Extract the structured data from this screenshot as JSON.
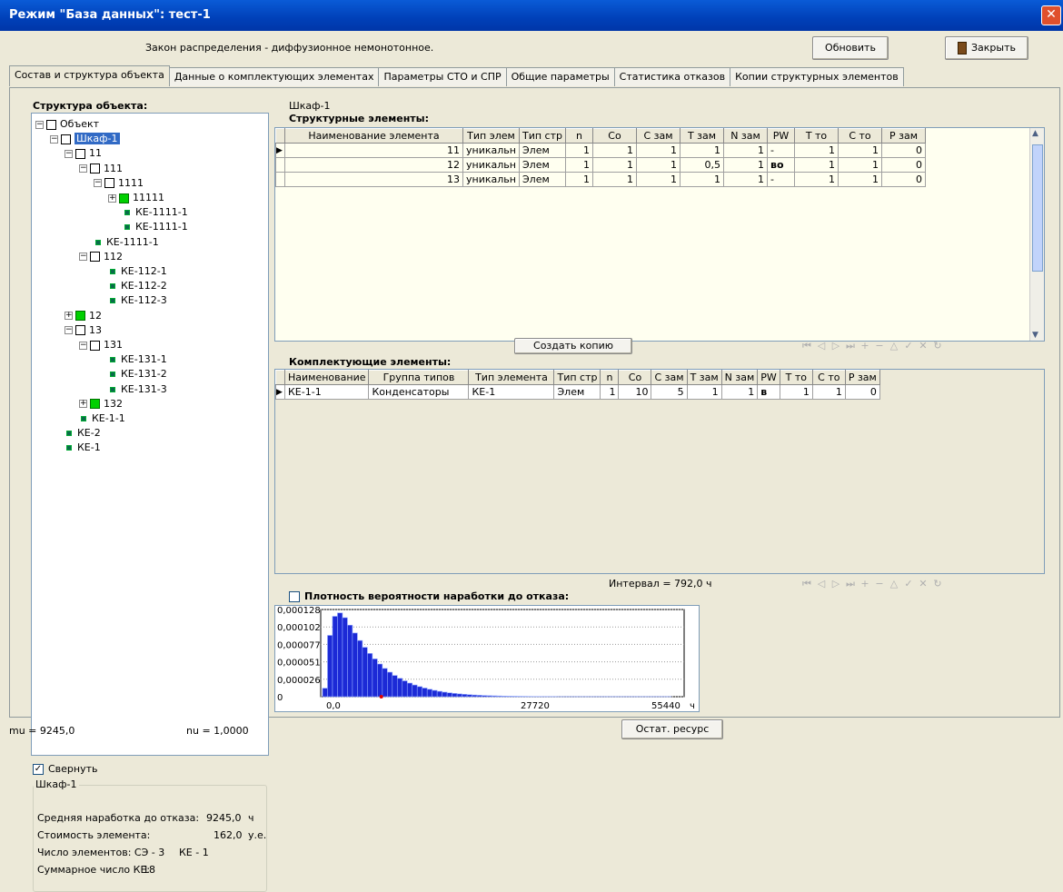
{
  "window": {
    "title": "Режим \"База данных\": тест-1",
    "close": "✕"
  },
  "header": {
    "law_label": "Закон распределения - диффузионное немонотонное.",
    "refresh": "Обновить",
    "close": "Закрыть"
  },
  "tabs": [
    "Состав и структура объекта",
    "Данные о комплектующих элементах",
    "Параметры СТО и СПР",
    "Общие параметры",
    "Статистика отказов",
    "Копии структурных элементов"
  ],
  "tree": {
    "title": "Структура объекта:",
    "nodes": [
      {
        "label": "Объект",
        "level": 0,
        "icon": "box",
        "exp": "−"
      },
      {
        "label": "Шкаф-1",
        "level": 1,
        "icon": "box",
        "exp": "−",
        "selected": true
      },
      {
        "label": "11",
        "level": 2,
        "icon": "box",
        "exp": "−"
      },
      {
        "label": "111",
        "level": 3,
        "icon": "box",
        "exp": "−"
      },
      {
        "label": "1111",
        "level": 4,
        "icon": "box",
        "exp": "−"
      },
      {
        "label": "11111",
        "level": 5,
        "icon": "green",
        "exp": "+"
      },
      {
        "label": "КЕ-1111-1",
        "level": 6,
        "icon": "sq",
        "exp": ""
      },
      {
        "label": "КЕ-1111-1",
        "level": 6,
        "icon": "sq",
        "exp": ""
      },
      {
        "label": "КЕ-1111-1",
        "level": 4,
        "icon": "sq",
        "exp": ""
      },
      {
        "label": "112",
        "level": 3,
        "icon": "plain",
        "exp": "−"
      },
      {
        "label": "КЕ-112-1",
        "level": 5,
        "icon": "sq",
        "exp": ""
      },
      {
        "label": "КЕ-112-2",
        "level": 5,
        "icon": "sq",
        "exp": ""
      },
      {
        "label": "КЕ-112-3",
        "level": 5,
        "icon": "sq",
        "exp": ""
      },
      {
        "label": "12",
        "level": 2,
        "icon": "green",
        "exp": "+"
      },
      {
        "label": "13",
        "level": 2,
        "icon": "box",
        "exp": "−"
      },
      {
        "label": "131",
        "level": 3,
        "icon": "plain",
        "exp": "−"
      },
      {
        "label": "КЕ-131-1",
        "level": 5,
        "icon": "sq",
        "exp": ""
      },
      {
        "label": "КЕ-131-2",
        "level": 5,
        "icon": "sq",
        "exp": ""
      },
      {
        "label": "КЕ-131-3",
        "level": 5,
        "icon": "sq",
        "exp": ""
      },
      {
        "label": "132",
        "level": 3,
        "icon": "green",
        "exp": "+"
      },
      {
        "label": "КЕ-1-1",
        "level": 3,
        "icon": "sq",
        "exp": ""
      },
      {
        "label": "КЕ-2",
        "level": 2,
        "icon": "sq",
        "exp": ""
      },
      {
        "label": "КЕ-1",
        "level": 2,
        "icon": "sq",
        "exp": ""
      }
    ]
  },
  "collapse": {
    "label": "Свернуть",
    "checked": true
  },
  "info": {
    "title": "Шкаф-1",
    "mtbf_label": "Средняя наработка до отказа:",
    "mtbf_value": "9245,0",
    "mtbf_unit": "ч",
    "cost_label": "Стоимость элемента:",
    "cost_value": "162,0",
    "cost_unit": "у.е.",
    "count_label": "Число элементов: СЭ - 3",
    "count_ke": "КЕ - 1",
    "sum_label": "Суммарное число КЕ:",
    "sum_value": "18"
  },
  "selected_name": "Шкаф-1",
  "struct": {
    "title": "Структурные элементы:",
    "headers": [
      "Наименование элемента",
      "Тип элем",
      "Тип стр",
      "n",
      "Co",
      "С зам",
      "Т зам",
      "N зам",
      "PW",
      "Т то",
      "С то",
      "Р зам"
    ],
    "rows": [
      [
        "11",
        "уникальн",
        "Элем",
        "1",
        "1",
        "1",
        "1",
        "1",
        "-",
        "1",
        "1",
        "0"
      ],
      [
        "12",
        "уникальн",
        "Элем",
        "1",
        "1",
        "1",
        "0,5",
        "1",
        "во",
        "1",
        "1",
        "0"
      ],
      [
        "13",
        "уникальн",
        "Элем",
        "1",
        "1",
        "1",
        "1",
        "1",
        "-",
        "1",
        "1",
        "0"
      ]
    ]
  },
  "copy_button": "Создать копию",
  "comp": {
    "title": "Комплектующие элементы:",
    "headers": [
      "Наименование",
      "Группа типов",
      "Тип элемента",
      "Тип стр",
      "n",
      "Co",
      "С зам",
      "Т зам",
      "N зам",
      "PW",
      "Т то",
      "С то",
      "Р зам"
    ],
    "rows": [
      [
        "КЕ-1-1",
        "Конденсаторы",
        "КЕ-1",
        "Элем",
        "1",
        "10",
        "5",
        "1",
        "1",
        "в",
        "1",
        "1",
        "0"
      ]
    ]
  },
  "nav_icons": [
    "⏮",
    "◁",
    "▷",
    "⏭",
    "+",
    "−",
    "△",
    "✓",
    "✕",
    "↻"
  ],
  "interval": "Интервал = 792,0 ч",
  "density": {
    "label": "Плотность вероятности наработки до отказа:",
    "checked": false
  },
  "chart_data": {
    "type": "bar",
    "yticks": [
      "0,000128",
      "0,000102",
      "0,000077",
      "0,000051",
      "0,000026",
      "0"
    ],
    "xticks": [
      "0,0",
      "27720",
      "55440"
    ],
    "xunit": "ч",
    "xlim": [
      0,
      55440
    ],
    "ylim": [
      0,
      0.000128
    ],
    "values": [
      1.25e-05,
      9e-05,
      0.000118,
      0.000123,
      0.000116,
      0.000105,
      9.35e-05,
      8.25e-05,
      7.25e-05,
      6.35e-05,
      5.55e-05,
      4.8e-05,
      4.15e-05,
      3.6e-05,
      3.12e-05,
      2.7e-05,
      2.33e-05,
      2e-05,
      1.72e-05,
      1.48e-05,
      1.27e-05,
      1.09e-05,
      9.3e-06,
      7.9e-06,
      6.7e-06,
      5.7e-06,
      4.8e-06,
      4.1e-06,
      3.5e-06,
      3e-06,
      2.5e-06,
      2.1e-06,
      1.8e-06,
      1.5e-06,
      1.3e-06,
      1.1e-06,
      9e-07,
      8e-07,
      7e-07,
      6e-07,
      5e-07,
      4e-07,
      3e-07,
      3e-07,
      2e-07,
      2e-07,
      2e-07,
      1e-07,
      1e-07,
      1e-07,
      1e-07,
      1e-07,
      1e-07,
      1e-07,
      1e-07,
      1e-07,
      1e-07,
      1e-07,
      1e-07,
      1e-07,
      1e-07,
      1e-07,
      1e-07,
      1e-07,
      1e-07,
      1e-07,
      1e-07,
      1e-07,
      1e-07,
      1e-07
    ],
    "marker_x": 9245
  },
  "status": {
    "mu": "mu = 9245,0",
    "nu": "nu = 1,0000",
    "residual": "Остат. ресурс"
  }
}
